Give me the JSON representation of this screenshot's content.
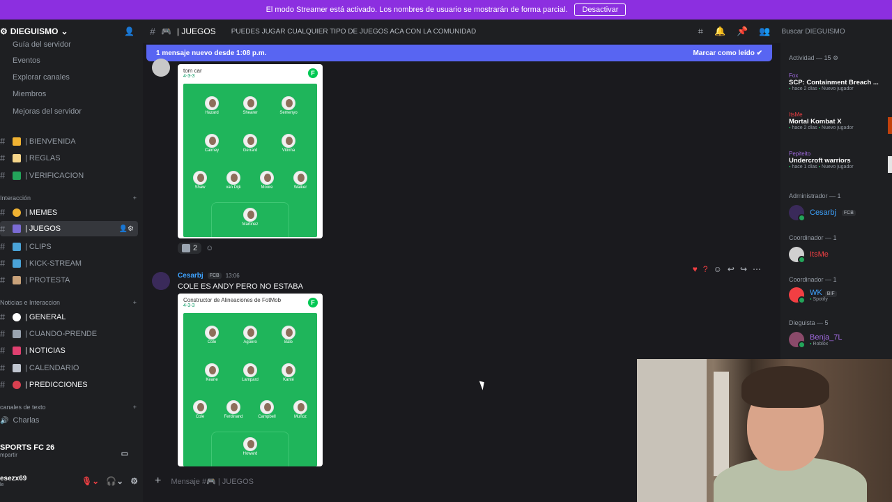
{
  "banner": {
    "text": "El modo Streamer está activado. Los nombres de usuario se mostrarán de forma parcial.",
    "button": "Desactivar"
  },
  "server": {
    "name": "DIEGUISMO"
  },
  "channel": {
    "name": "| JUEGOS",
    "topic": "PUEDES JUGAR CUALQUIER TIPO DE JUEGOS ACA CON LA COMUNIDAD"
  },
  "search": {
    "placeholder": "Buscar DIEGUISMO"
  },
  "sidebar": {
    "top_items": [
      "Guía del servidor",
      "Eventos",
      "Explorar canales",
      "Miembros",
      "Mejoras del servidor"
    ],
    "channels_a": [
      "| BIENVENIDA",
      "| REGLAS",
      "| VERIFICACION"
    ],
    "cat_interaccion": "Interacción",
    "channels_b": [
      "| MEMES",
      "| JUEGOS",
      "| CLIPS",
      "| KICK-STREAM",
      "| PROTESTA"
    ],
    "cat_noticias": "Noticias e Interaccion",
    "channels_c": [
      "| GENERAL",
      "| CUANDO-PRENDE",
      "| NOTICIAS",
      "| CALENDARIO",
      "| PREDICCIONES"
    ],
    "cat_texto": "canales de texto",
    "charlas": "Charlas",
    "voice_title": "SPORTS FC 26",
    "voice_sub": "mpartir",
    "user": "esezx69",
    "user_sub": "le"
  },
  "main": {
    "new_messages": "1 mensaje nuevo desde 1:08 p.m.",
    "mark_read": "Marcar como leído",
    "card1": {
      "title": "tom car",
      "formation": "4-3-3",
      "players": [
        "Hazard",
        "Shearer",
        "Semenyo",
        "Caimey",
        "Gerrard",
        "Vitinha",
        "Shaw",
        "van Dijk",
        "Moore",
        "Walker",
        "Martinez"
      ]
    },
    "reaction_count": "2",
    "msg_author": "Cesarbj",
    "msg_tag": "FCB",
    "msg_time": "13:06",
    "msg_text": "COLE ES ANDY PERO NO ESTABA",
    "card2": {
      "title": "Constructor de Alineaciones de FotMob",
      "formation": "4-3-3",
      "players": [
        "Cole",
        "Agüero",
        "Bale",
        "Keane",
        "Lampard",
        "Kanté",
        "Cole",
        "Ferdinand",
        "Campbell",
        "Muñoz",
        "Howard"
      ]
    },
    "composer_placeholder": "Mensaje #🎮 | JUEGOS"
  },
  "members": {
    "activity_header": "Actividad — 15",
    "activities": [
      {
        "user": "Fox",
        "game": "SCP: Containment Breach ...",
        "when": "hace 2 días",
        "tag": "Nuevo jugador"
      },
      {
        "user": "ItsMe",
        "game": "Mortal Kombat X",
        "when": "hace 2 días",
        "tag": "Nuevo jugador"
      },
      {
        "user": "Pepiteito",
        "game": "Undercroft warriors",
        "when": "hace 1 días",
        "tag": "Nuevo jugador"
      }
    ],
    "admin_header": "Administrador — 1",
    "admin": {
      "name": "Cesarbj",
      "tag": "FCB"
    },
    "coord1_header": "Coordinador — 1",
    "coord1": {
      "name": "ItsMe"
    },
    "coord2_header": "Coordinador — 1",
    "coord2": {
      "name": "WK",
      "tag": "BIF",
      "sub": "Spotify"
    },
    "dieguista_header": "Dieguista — 5",
    "dieguista1": {
      "name": "Benja_7L",
      "sub": "Roblox"
    }
  },
  "colors": {
    "banner": "#8c2fe0",
    "accent": "#5865f2",
    "pitch": "#1fb55b",
    "online": "#23a55a"
  },
  "icons": [
    "hash-icon",
    "gear-icon",
    "bell-icon",
    "pin-icon",
    "members-icon",
    "threads-icon",
    "add-member-icon",
    "plus-icon",
    "headphones-icon",
    "mic-muted-icon"
  ]
}
